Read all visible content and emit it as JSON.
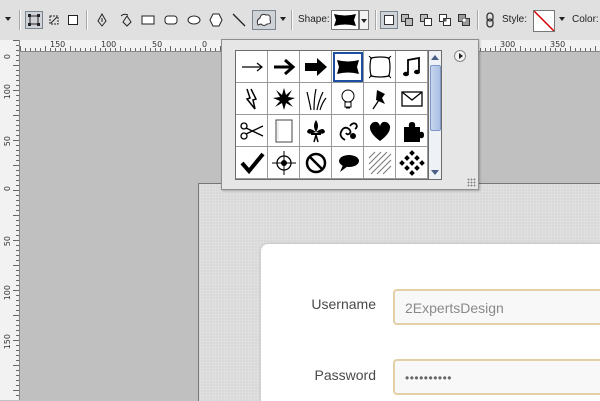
{
  "options_bar": {
    "shape_label": "Shape:",
    "style_label": "Style:",
    "color_label": "Color:",
    "tools": [
      "shape-layers-icon",
      "paths-icon",
      "fill-pixels-icon",
      "pen-icon",
      "freeform-pen-icon",
      "rectangle-icon",
      "rounded-rectangle-icon",
      "ellipse-icon",
      "polygon-icon",
      "line-icon",
      "custom-shape-icon"
    ],
    "combine_modes": [
      "new-area-icon",
      "add-area-icon",
      "subtract-area-icon",
      "intersect-area-icon",
      "exclude-area-icon"
    ],
    "link_icon": "link-icon",
    "style_value": "none"
  },
  "ruler_top": [
    "150",
    "100",
    "50",
    "0",
    "300",
    "350"
  ],
  "ruler_left": [
    "0",
    "1\n0\n0",
    "5\n0",
    "0",
    "5\n0",
    "1\n0\n0",
    "1\n5\n0"
  ],
  "shape_picker": {
    "shapes": [
      "thin-arrow-icon",
      "arrow-icon",
      "bold-arrow-icon",
      "banner-icon",
      "frame-icon",
      "music-note-icon",
      "lightning-icon",
      "starburst-icon",
      "grass-icon",
      "lightbulb-icon",
      "pushpin-icon",
      "envelope-icon",
      "scissors-icon",
      "blank-page-icon",
      "fleur-de-lis-icon",
      "ornament-icon",
      "heart-icon",
      "puzzle-icon",
      "checkmark-icon",
      "crosshair-icon",
      "no-sign-icon",
      "speech-bubble-icon",
      "hatch-pattern-icon",
      "checker-diamond-icon"
    ],
    "selected": "banner-icon"
  },
  "login_form": {
    "username_label": "Username",
    "username_value": "2ExpertsDesign",
    "password_label": "Password",
    "password_value": "••••••••••"
  }
}
